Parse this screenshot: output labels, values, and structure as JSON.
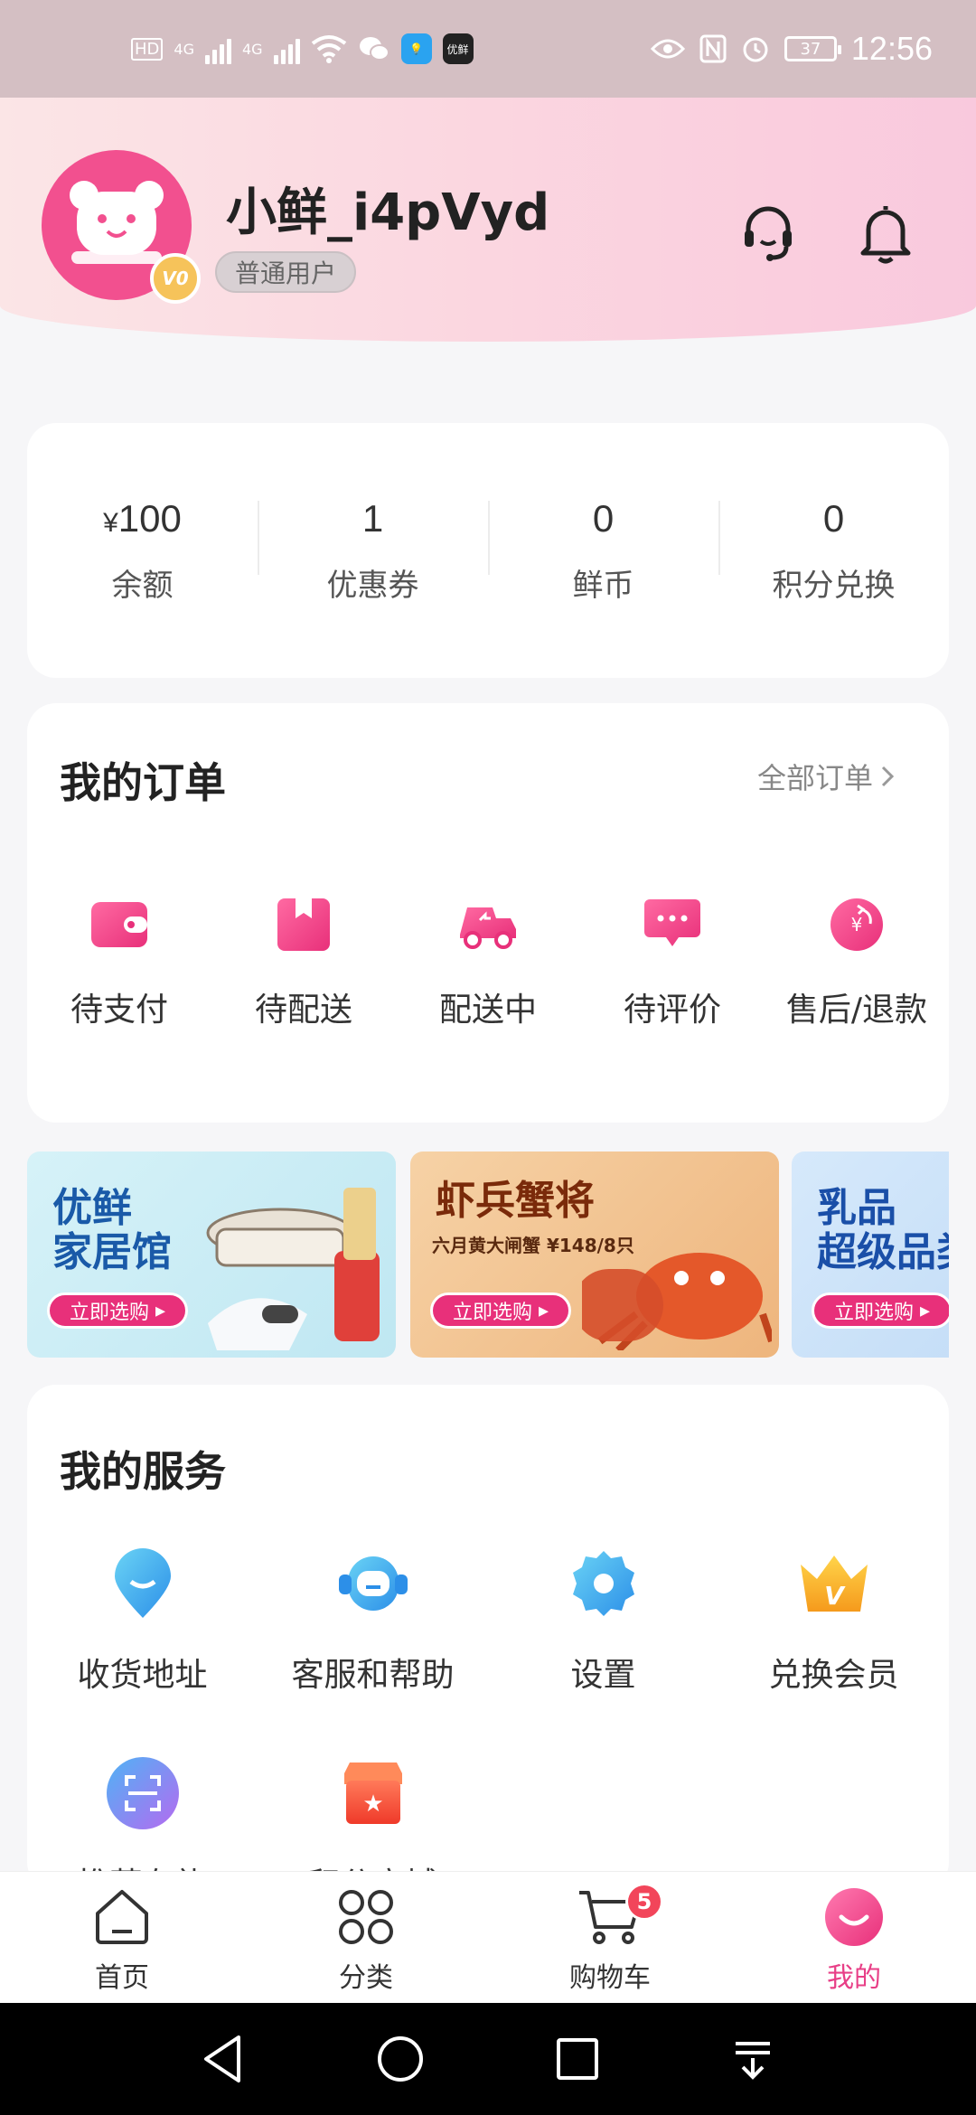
{
  "status_bar": {
    "time": "12:56",
    "battery": "37",
    "net_left": "HD",
    "net_tag1": "4G",
    "net_tag2": "4G",
    "app_chip": "优鲜"
  },
  "header": {
    "username": "小鲜_i4pVyd",
    "user_level": "普通用户",
    "avatar_badge": "V0"
  },
  "stats": [
    {
      "currency": "¥",
      "value": "100",
      "label": "余额"
    },
    {
      "value": "1",
      "label": "优惠券"
    },
    {
      "value": "0",
      "label": "鲜币"
    },
    {
      "value": "0",
      "label": "积分兑换"
    }
  ],
  "orders": {
    "title": "我的订单",
    "all_label": "全部订单",
    "items": [
      {
        "label": "待支付",
        "icon": "wallet-icon"
      },
      {
        "label": "待配送",
        "icon": "package-icon"
      },
      {
        "label": "配送中",
        "icon": "delivery-truck-icon"
      },
      {
        "label": "待评价",
        "icon": "comment-icon"
      },
      {
        "label": "售后/退款",
        "icon": "refund-icon"
      }
    ]
  },
  "banners": [
    {
      "title_line1": "优鲜",
      "title_line2": "家居馆",
      "button": "立即选购"
    },
    {
      "title_line1": "虾兵蟹将",
      "subtitle": "六月黄大闸蟹 ¥148/8只",
      "button": "立即选购"
    },
    {
      "title_line1": "乳品",
      "title_line2": "超级品类",
      "button": "立即选购"
    }
  ],
  "services": {
    "title": "我的服务",
    "items": [
      {
        "label": "收货地址",
        "icon": "location-pin-icon"
      },
      {
        "label": "客服和帮助",
        "icon": "customer-service-icon"
      },
      {
        "label": "设置",
        "icon": "gear-icon"
      },
      {
        "label": "兑换会员",
        "icon": "vip-crown-icon"
      },
      {
        "label": "推荐有礼",
        "icon": "scan-icon"
      },
      {
        "label": "积分商城",
        "icon": "store-icon"
      }
    ]
  },
  "tabbar": {
    "items": [
      {
        "label": "首页",
        "icon": "home-icon"
      },
      {
        "label": "分类",
        "icon": "category-icon"
      },
      {
        "label": "购物车",
        "icon": "cart-icon",
        "badge": "5"
      },
      {
        "label": "我的",
        "icon": "profile-icon",
        "active": true
      }
    ]
  },
  "colors": {
    "accent": "#e83f87",
    "header_bg": "#fbd6e0",
    "badge": "#f2455a"
  }
}
